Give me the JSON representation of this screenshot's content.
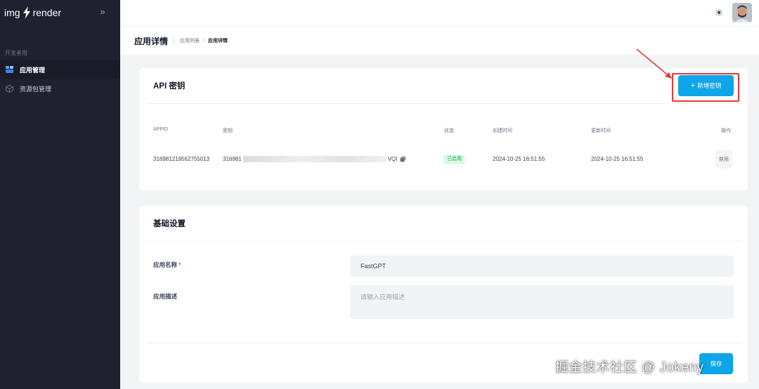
{
  "app": {
    "logo_left": "img",
    "logo_right": "render"
  },
  "sidebar": {
    "section_label": "开发者用",
    "items": [
      {
        "label": "应用管理",
        "icon": "app-grid-icon",
        "active": true
      },
      {
        "label": "资源包管理",
        "icon": "package-icon",
        "active": false
      }
    ]
  },
  "header": {
    "title": "应用详情",
    "breadcrumb": [
      "应用列表",
      "应用详情"
    ]
  },
  "api_card": {
    "title": "API 密钥",
    "new_key_button": "新增密钥",
    "columns": [
      "APPID",
      "密钥",
      "状态",
      "创建时间",
      "更新时间",
      "操作"
    ],
    "rows": [
      {
        "appid": "316981219562755013",
        "secret_prefix": "316981",
        "secret_suffix": "VQI",
        "status": "已启用",
        "created": "2024-10-25 16:51:55",
        "updated": "2024-10-25 16:51:55",
        "action": "禁用"
      }
    ]
  },
  "basic_card": {
    "title": "基础设置",
    "name_label": "应用名称",
    "required_mark": "*",
    "name_value": "FastGPT",
    "desc_label": "应用描述",
    "desc_placeholder": "请输入应用描述",
    "save_button": "保存"
  },
  "watermark": "掘金技术社区 @ Jokeny",
  "colors": {
    "sidebar_bg": "#1f2030",
    "primary": "#0ea5e9",
    "status_green": "#16a34a",
    "annotation_red": "#e53935"
  }
}
